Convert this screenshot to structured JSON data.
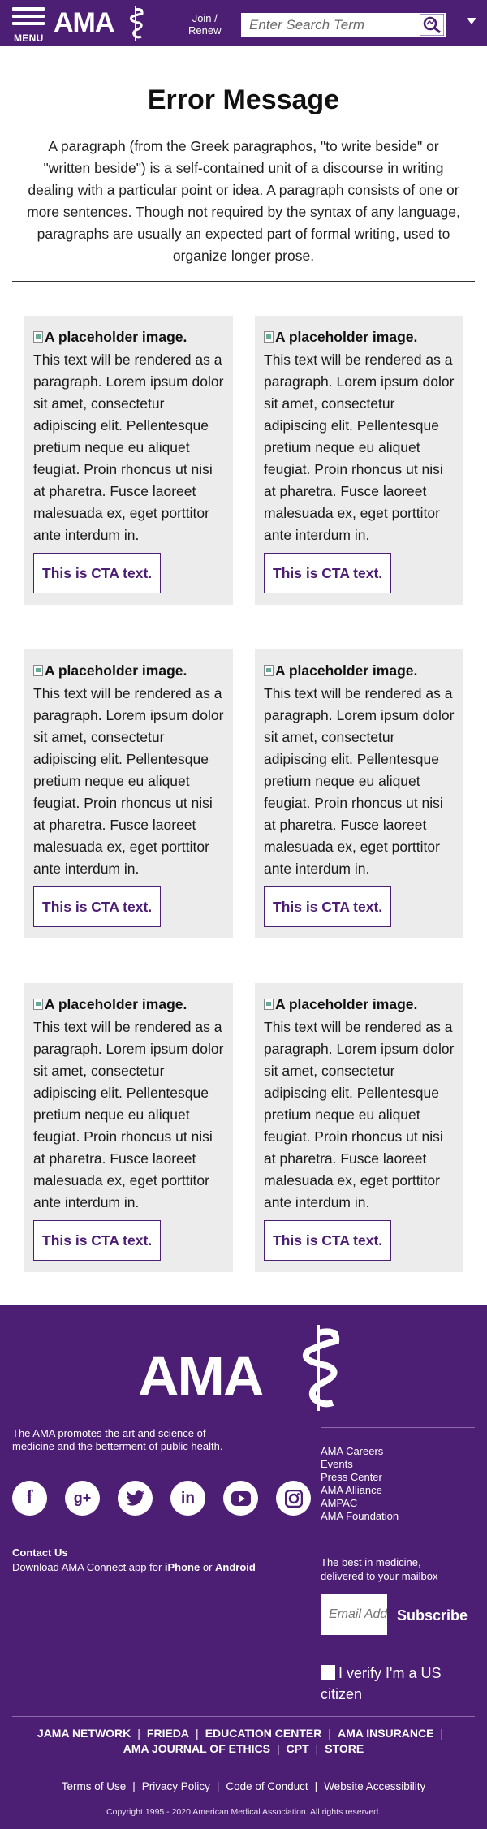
{
  "header": {
    "menu_label": "MENU",
    "logo_text": "AMA",
    "join_line1": "Join /",
    "join_line2": "Renew",
    "search_placeholder": "Enter Search Term"
  },
  "page": {
    "title": "Error Message",
    "intro": "A paragraph (from the Greek paragraphos, \"to write beside\" or \"written beside\") is a self-contained unit of a discourse in writing dealing with a particular point or idea. A paragraph consists of one or more sentences. Though not required by the syntax of any language, paragraphs are usually an expected part of formal writing, used to organize longer prose."
  },
  "cards": [
    {
      "img_alt": "A placeholder image.",
      "text": "This text will be rendered as a paragraph. Lorem ipsum dolor sit amet, consectetur adipiscing elit. Pellentesque pretium neque eu aliquet feugiat. Proin rhoncus ut nisi at pharetra. Fusce laoreet malesuada ex, eget porttitor ante interdum in.",
      "cta": "This is CTA text."
    },
    {
      "img_alt": "A placeholder image.",
      "text": "This text will be rendered as a paragraph. Lorem ipsum dolor sit amet, consectetur adipiscing elit. Pellentesque pretium neque eu aliquet feugiat. Proin rhoncus ut nisi at pharetra. Fusce laoreet malesuada ex, eget porttitor ante interdum in.",
      "cta": "This is CTA text."
    },
    {
      "img_alt": "A placeholder image.",
      "text": "This text will be rendered as a paragraph. Lorem ipsum dolor sit amet, consectetur adipiscing elit. Pellentesque pretium neque eu aliquet feugiat. Proin rhoncus ut nisi at pharetra. Fusce laoreet malesuada ex, eget porttitor ante interdum in.",
      "cta": "This is CTA text."
    },
    {
      "img_alt": "A placeholder image.",
      "text": "This text will be rendered as a paragraph. Lorem ipsum dolor sit amet, consectetur adipiscing elit. Pellentesque pretium neque eu aliquet feugiat. Proin rhoncus ut nisi at pharetra. Fusce laoreet malesuada ex, eget porttitor ante interdum in.",
      "cta": "This is CTA text."
    },
    {
      "img_alt": "A placeholder image.",
      "text": "This text will be rendered as a paragraph. Lorem ipsum dolor sit amet, consectetur adipiscing elit. Pellentesque pretium neque eu aliquet feugiat. Proin rhoncus ut nisi at pharetra. Fusce laoreet malesuada ex, eget porttitor ante interdum in.",
      "cta": "This is CTA text."
    },
    {
      "img_alt": "A placeholder image.",
      "text": "This text will be rendered as a paragraph. Lorem ipsum dolor sit amet, consectetur adipiscing elit. Pellentesque pretium neque eu aliquet feugiat. Proin rhoncus ut nisi at pharetra. Fusce laoreet malesuada ex, eget porttitor ante interdum in.",
      "cta": "This is CTA text."
    }
  ],
  "footer": {
    "logo_text": "AMA",
    "mission": "The AMA promotes the art and science of medicine and the betterment of public health.",
    "links": [
      "AMA Careers",
      "Events",
      "Press Center",
      "AMA Alliance",
      "AMPAC",
      "AMA Foundation"
    ],
    "socials": [
      {
        "icon": "facebook-icon",
        "glyph": "f"
      },
      {
        "icon": "google-plus-icon",
        "glyph": "g+"
      },
      {
        "icon": "twitter-icon",
        "glyph": "t"
      },
      {
        "icon": "linkedin-icon",
        "glyph": "in"
      },
      {
        "icon": "youtube-icon",
        "glyph": "▶"
      },
      {
        "icon": "instagram-icon",
        "glyph": "◎"
      }
    ],
    "contact_label": "Contact Us",
    "app_prefix": "Download AMA Connect app for ",
    "app_iphone": "iPhone",
    "app_or": " or ",
    "app_android": "Android",
    "newsletter_line1": "The best in medicine,",
    "newsletter_line2": "delivered to your mailbox",
    "email_placeholder": "Email Address",
    "subscribe_label": "Subscribe",
    "verify_label": "I verify I'm a US citizen",
    "partners_row1": [
      "JAMA NETWORK",
      "FRIEDA",
      "EDUCATION CENTER",
      "AMA INSURANCE"
    ],
    "partners_row2": [
      "AMA JOURNAL OF ETHICS",
      "CPT",
      "STORE"
    ],
    "legal": [
      "Terms of Use",
      "Privacy Policy",
      "Code of Conduct",
      "Website Accessibility"
    ],
    "copyright": "Copyright 1995 - 2020 American Medical Association. All rights reserved.",
    "colors": {
      "brand": "#4d1f74",
      "card_bg": "#ececec"
    }
  }
}
